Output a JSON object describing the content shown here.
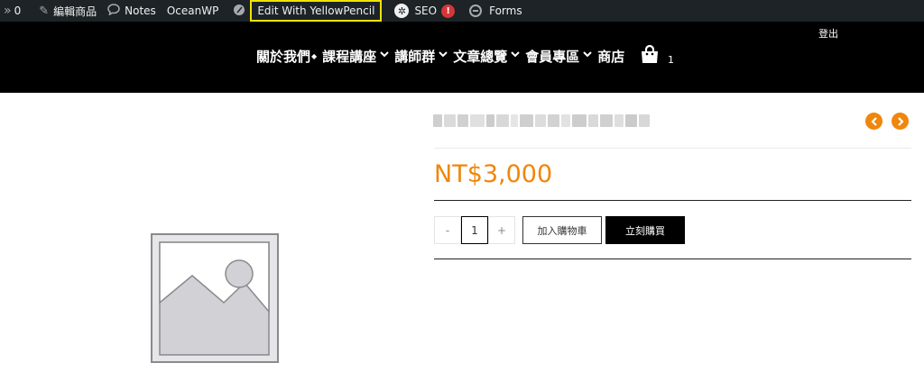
{
  "adminbar": {
    "updates_count": "0",
    "edit_product": "編輯商品",
    "notes": "Notes",
    "oceanwp": "OceanWP",
    "yellowpencil": "Edit With YellowPencil",
    "seo": "SEO",
    "seo_badge": "!",
    "forms": "Forms"
  },
  "header": {
    "logout": "登出",
    "nav": [
      {
        "label": "關於我們",
        "caret": "◆"
      },
      {
        "label": "課程講座",
        "caret": "❯"
      },
      {
        "label": "講師群",
        "caret": "❯"
      },
      {
        "label": "文章總覽",
        "caret": "❯"
      },
      {
        "label": "會員專區",
        "caret": "❯"
      },
      {
        "label": "商店",
        "caret": ""
      }
    ],
    "cart_count": "1"
  },
  "product": {
    "price": "NT$3,000",
    "qty_minus": "-",
    "qty_value": "1",
    "qty_plus": "+",
    "add_to_cart": "加入購物車",
    "buy_now": "立刻購買"
  },
  "colors": {
    "accent": "#f0860b",
    "adminbar_bg": "#1d2327",
    "header_bg": "#000000"
  }
}
